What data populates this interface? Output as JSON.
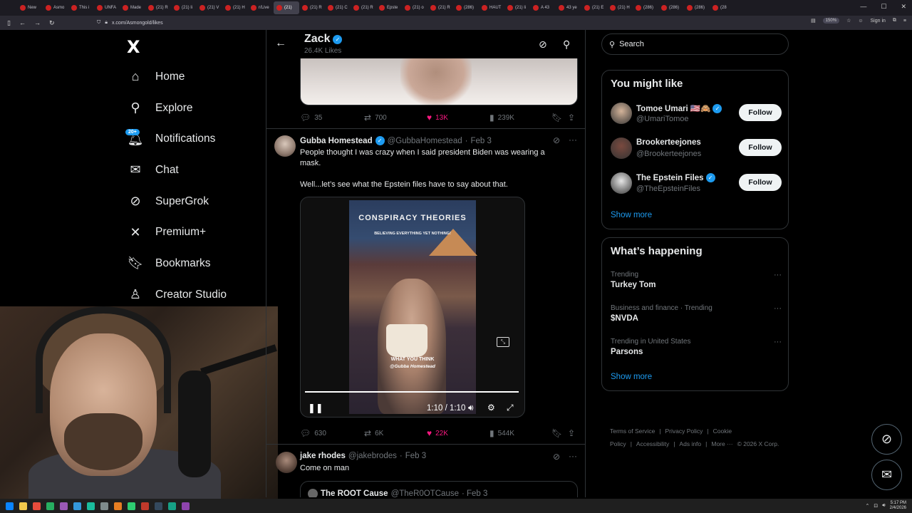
{
  "browser": {
    "tabs": [
      {
        "label": "New"
      },
      {
        "label": "Asmo"
      },
      {
        "label": "This i"
      },
      {
        "label": "UNFA"
      },
      {
        "label": "Made"
      },
      {
        "label": "(21) R"
      },
      {
        "label": "(21) li"
      },
      {
        "label": "(21) V"
      },
      {
        "label": "(21) H"
      },
      {
        "label": "r/Live"
      },
      {
        "label": "(21) ",
        "active": true
      },
      {
        "label": "(21) R"
      },
      {
        "label": "(21) C"
      },
      {
        "label": "(21) R"
      },
      {
        "label": "Epste"
      },
      {
        "label": "(21) o"
      },
      {
        "label": "(21) R"
      },
      {
        "label": "(286)"
      },
      {
        "label": "HAUT"
      },
      {
        "label": "(21) li"
      },
      {
        "label": "A 43"
      },
      {
        "label": "43 ye"
      },
      {
        "label": "(21) E"
      },
      {
        "label": "(21) H"
      },
      {
        "label": "(286)"
      },
      {
        "label": "(286)"
      },
      {
        "label": "(286)"
      },
      {
        "label": "(28"
      }
    ],
    "url": "x.com/Asmongold/likes",
    "zoom": "150%",
    "sign_in": "Sign in"
  },
  "sidebar": {
    "logo": "X",
    "items": [
      {
        "label": "Home",
        "icon": "home-icon",
        "glyph": "⌂"
      },
      {
        "label": "Explore",
        "icon": "search-icon",
        "glyph": "⚲"
      },
      {
        "label": "Notifications",
        "icon": "bell-icon",
        "glyph": "🔔︎",
        "badge": "20+"
      },
      {
        "label": "Chat",
        "icon": "mail-icon",
        "glyph": "✉"
      },
      {
        "label": "SuperGrok",
        "icon": "grok-icon",
        "glyph": "⊘"
      },
      {
        "label": "Premium+",
        "icon": "x-icon",
        "glyph": "✕"
      },
      {
        "label": "Bookmarks",
        "icon": "bookmark-icon",
        "glyph": "🔖︎"
      },
      {
        "label": "Creator Studio",
        "icon": "flask-icon",
        "glyph": "♙"
      }
    ]
  },
  "header": {
    "name": "Zack",
    "likes": "26.4K Likes"
  },
  "prev_tweet": {
    "replies": "35",
    "reposts": "700",
    "likes": "13K",
    "views": "239K"
  },
  "tweet": {
    "name": "Gubba Homestead",
    "handle": "@GubbaHomestead",
    "sep": "·",
    "date": "Feb 3",
    "text1": "People thought I was crazy when I said president Biden was wearing a mask.",
    "text2": "Well...let’s see what the Epstein files have to say about that.",
    "video": {
      "title": "CONSPIRACY THEORIES",
      "subtitle": "BELIEVING EVERYTHING YET NOTHING!",
      "caption1": "WHAT YOU THINK",
      "caption2": "@Gubba Homestead",
      "time": "1:10 / 1:10",
      "progress": 1.0
    },
    "replies": "630",
    "reposts": "6K",
    "likes": "22K",
    "views": "544K"
  },
  "reply_tweet": {
    "name": "jake rhodes",
    "handle": "@jakebrodes",
    "sep": "·",
    "date": "Feb 3",
    "text": "Come on man",
    "quote_name": "The ROOT Cause",
    "quote_handle": "@TheR0OTCause",
    "quote_date": "· Feb 3"
  },
  "right": {
    "search_placeholder": "Search",
    "might_like": {
      "title": "You might like",
      "users": [
        {
          "name": "Tomoe Umari 🇺🇸🙈",
          "handle": "@UmariTomoe",
          "verified": true,
          "button": "Follow"
        },
        {
          "name": "Brookerteejones",
          "handle": "@Brookerteejones",
          "verified": false,
          "button": "Follow"
        },
        {
          "name": "The Epstein Files",
          "handle": "@TheEpsteinFiles",
          "verified": true,
          "button": "Follow"
        }
      ],
      "show_more": "Show more"
    },
    "happening": {
      "title": "What’s happening",
      "trends": [
        {
          "meta": "Trending",
          "title": "Turkey Tom"
        },
        {
          "meta": "Business and finance · Trending",
          "title": "$NVDA"
        },
        {
          "meta": "Trending in United States",
          "title": "Parsons"
        }
      ],
      "show_more": "Show more"
    },
    "footer": {
      "links": [
        "Terms of Service",
        "|",
        "Privacy Policy",
        "|",
        "Cookie Policy",
        "|",
        "Accessibility",
        "|",
        "Ads info",
        "|",
        "More ···",
        "© 2026 X Corp."
      ]
    }
  },
  "taskbar": {
    "time": "5:17 PM",
    "date": "2/4/2026"
  },
  "colors": {
    "accent": "#1d9bf0",
    "like": "#f91880",
    "text_secondary": "#71767b",
    "border": "#2f3336"
  }
}
